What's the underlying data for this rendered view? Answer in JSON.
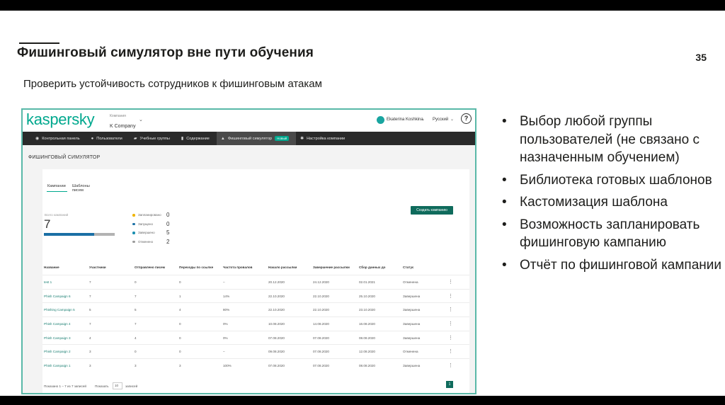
{
  "slide": {
    "title": "Фишинговый симулятор вне пути обучения",
    "page_number": "35",
    "subtitle": "Проверить устойчивость сотрудников к фишинговым атакам"
  },
  "app": {
    "logo": "kaspersky",
    "company_label": "Компания",
    "company_name": "K Company",
    "user_name": "Ekaterina Koshkina",
    "language": "Русский",
    "help": "?",
    "nav": [
      {
        "icon": "dashboard-icon",
        "label": "Контрольная панель"
      },
      {
        "icon": "users-icon",
        "label": "Пользователи"
      },
      {
        "icon": "groups-icon",
        "label": "Учебные группы"
      },
      {
        "icon": "content-icon",
        "label": "Содержание"
      },
      {
        "icon": "phishing-icon",
        "label": "Фишинговый симулятор",
        "badge": "Новый",
        "active": true
      },
      {
        "icon": "gear-icon",
        "label": "Настройка компании"
      }
    ],
    "page_heading": "ФИШИНГОВЫЙ СИМУЛЯТОР",
    "tabs": [
      "Кампании",
      "Шаблоны писем"
    ],
    "create_button": "Создать кампанию",
    "summary": {
      "total_label": "Всего кампаний",
      "total": "7",
      "legend": [
        {
          "label": "Запланировано",
          "value": "0",
          "color": "#f0b400"
        },
        {
          "label": "Запущено",
          "value": "0",
          "color": "#1a6fa5"
        },
        {
          "label": "Завершено",
          "value": "5",
          "color": "#1a8fb0"
        },
        {
          "label": "Отменено",
          "value": "2",
          "color": "#9a9a9a"
        }
      ],
      "completed_fraction": 0.714
    },
    "table": {
      "columns": [
        "Название",
        "Участники",
        "Отправлено писем",
        "Переходы по ссылке",
        "Частота провалов",
        "Начало рассылки",
        "Завершение рассылки",
        "Сбор данных до",
        "Статус"
      ],
      "rows": [
        [
          "test 1",
          "7",
          "0",
          "0",
          "–",
          "20.12.2020",
          "24.12.2020",
          "02.01.2021",
          "Отменена"
        ],
        [
          "Phish Campaign 6",
          "7",
          "7",
          "1",
          "14%",
          "22.10.2020",
          "22.10.2020",
          "25.10.2020",
          "Завершена"
        ],
        [
          "Phishing Campaign 5",
          "5",
          "5",
          "4",
          "80%",
          "22.10.2020",
          "22.10.2020",
          "23.10.2020",
          "Завершена"
        ],
        [
          "Phish Campaign 4",
          "7",
          "7",
          "0",
          "0%",
          "10.08.2020",
          "14.08.2020",
          "16.08.2020",
          "Завершена"
        ],
        [
          "Phish Campaign 3",
          "4",
          "4",
          "0",
          "0%",
          "07.08.2020",
          "07.08.2020",
          "08.08.2020",
          "Завершена"
        ],
        [
          "Phish Campaign 2",
          "3",
          "0",
          "0",
          "–",
          "09.08.2020",
          "07.08.2020",
          "12.08.2020",
          "Отменена"
        ],
        [
          "Phish Campaign 1",
          "3",
          "3",
          "3",
          "100%",
          "07.08.2020",
          "07.08.2020",
          "08.08.2020",
          "Завершена"
        ]
      ],
      "row_menu": "⋮"
    },
    "footer": {
      "info": "Показано 1 – 7 из 7 записей",
      "show": "Показать",
      "per_page": "10",
      "per_page_suffix": "записей",
      "current_page": "1"
    }
  },
  "bullets": [
    "Выбор любой группы пользователей (не связано с назначенным обучением)",
    "Библиотека готовых шаблонов",
    "Кастомизация шаблона",
    "Возможность запланировать фишинговую кампанию",
    "Отчёт по фишинговой кампании"
  ]
}
